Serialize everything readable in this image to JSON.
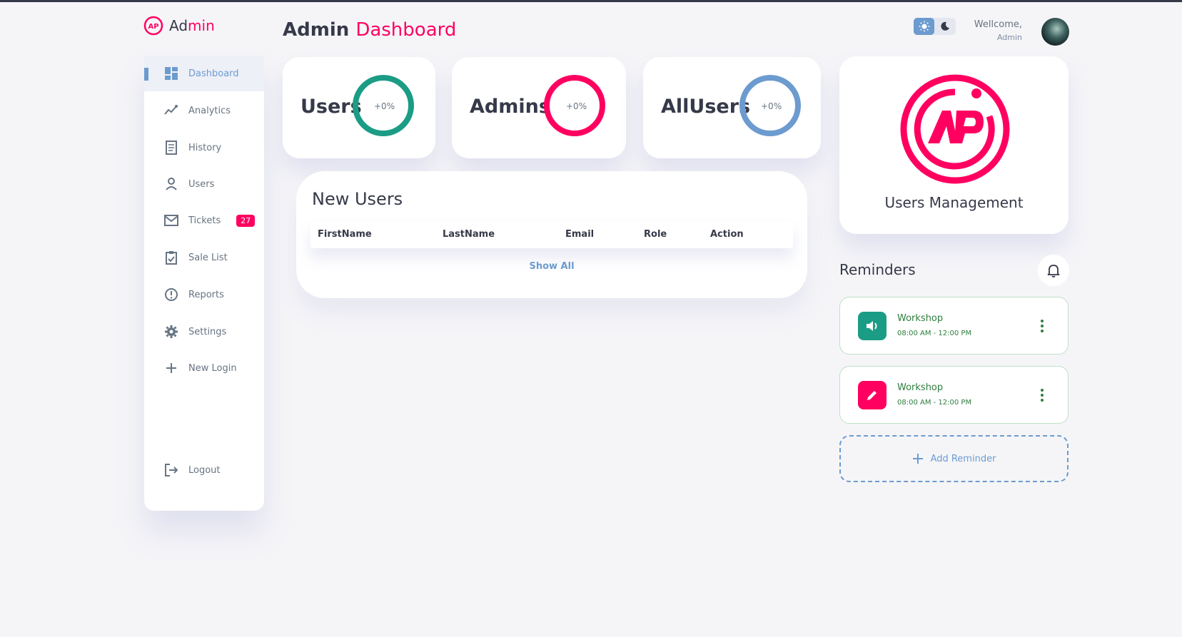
{
  "brand": {
    "prefix": "Ad",
    "suffix": "min"
  },
  "title": {
    "main": "Admin",
    "accent": "Dashboard"
  },
  "header": {
    "welcome": "Wellcome,",
    "user": "Admin"
  },
  "sidebar": {
    "items": [
      {
        "label": "Dashboard",
        "icon": "dashboard-icon"
      },
      {
        "label": "Analytics",
        "icon": "analytics-icon"
      },
      {
        "label": "History",
        "icon": "history-icon"
      },
      {
        "label": "Users",
        "icon": "user-icon"
      },
      {
        "label": "Tickets",
        "icon": "mail-icon",
        "badge": "27"
      },
      {
        "label": "Sale List",
        "icon": "clipboard-icon"
      },
      {
        "label": "Reports",
        "icon": "alert-icon"
      },
      {
        "label": "Settings",
        "icon": "gear-icon"
      },
      {
        "label": "New Login",
        "icon": "plus-icon"
      },
      {
        "label": "Logout",
        "icon": "logout-icon"
      }
    ]
  },
  "stats": [
    {
      "label": "Users",
      "percent": "+0%",
      "color": "#1b9c85"
    },
    {
      "label": "Admins",
      "percent": "+0%",
      "color": "#ff0060"
    },
    {
      "label": "AllUsers",
      "percent": "+0%",
      "color": "#6c9bcf"
    }
  ],
  "new_users": {
    "title": "New Users",
    "columns": [
      "FirstName",
      "LastName",
      "Email",
      "Role",
      "Action"
    ],
    "show_all": "Show All"
  },
  "management": {
    "title": "Users Management"
  },
  "reminders": {
    "title": "Reminders",
    "items": [
      {
        "name": "Workshop",
        "time": "08:00 AM - 12:00 PM",
        "icon": "volume-icon",
        "color": "#1b9c85"
      },
      {
        "name": "Workshop",
        "time": "08:00 AM - 12:00 PM",
        "icon": "edit-icon",
        "color": "#ff0060"
      }
    ],
    "add_label": "Add Reminder"
  }
}
